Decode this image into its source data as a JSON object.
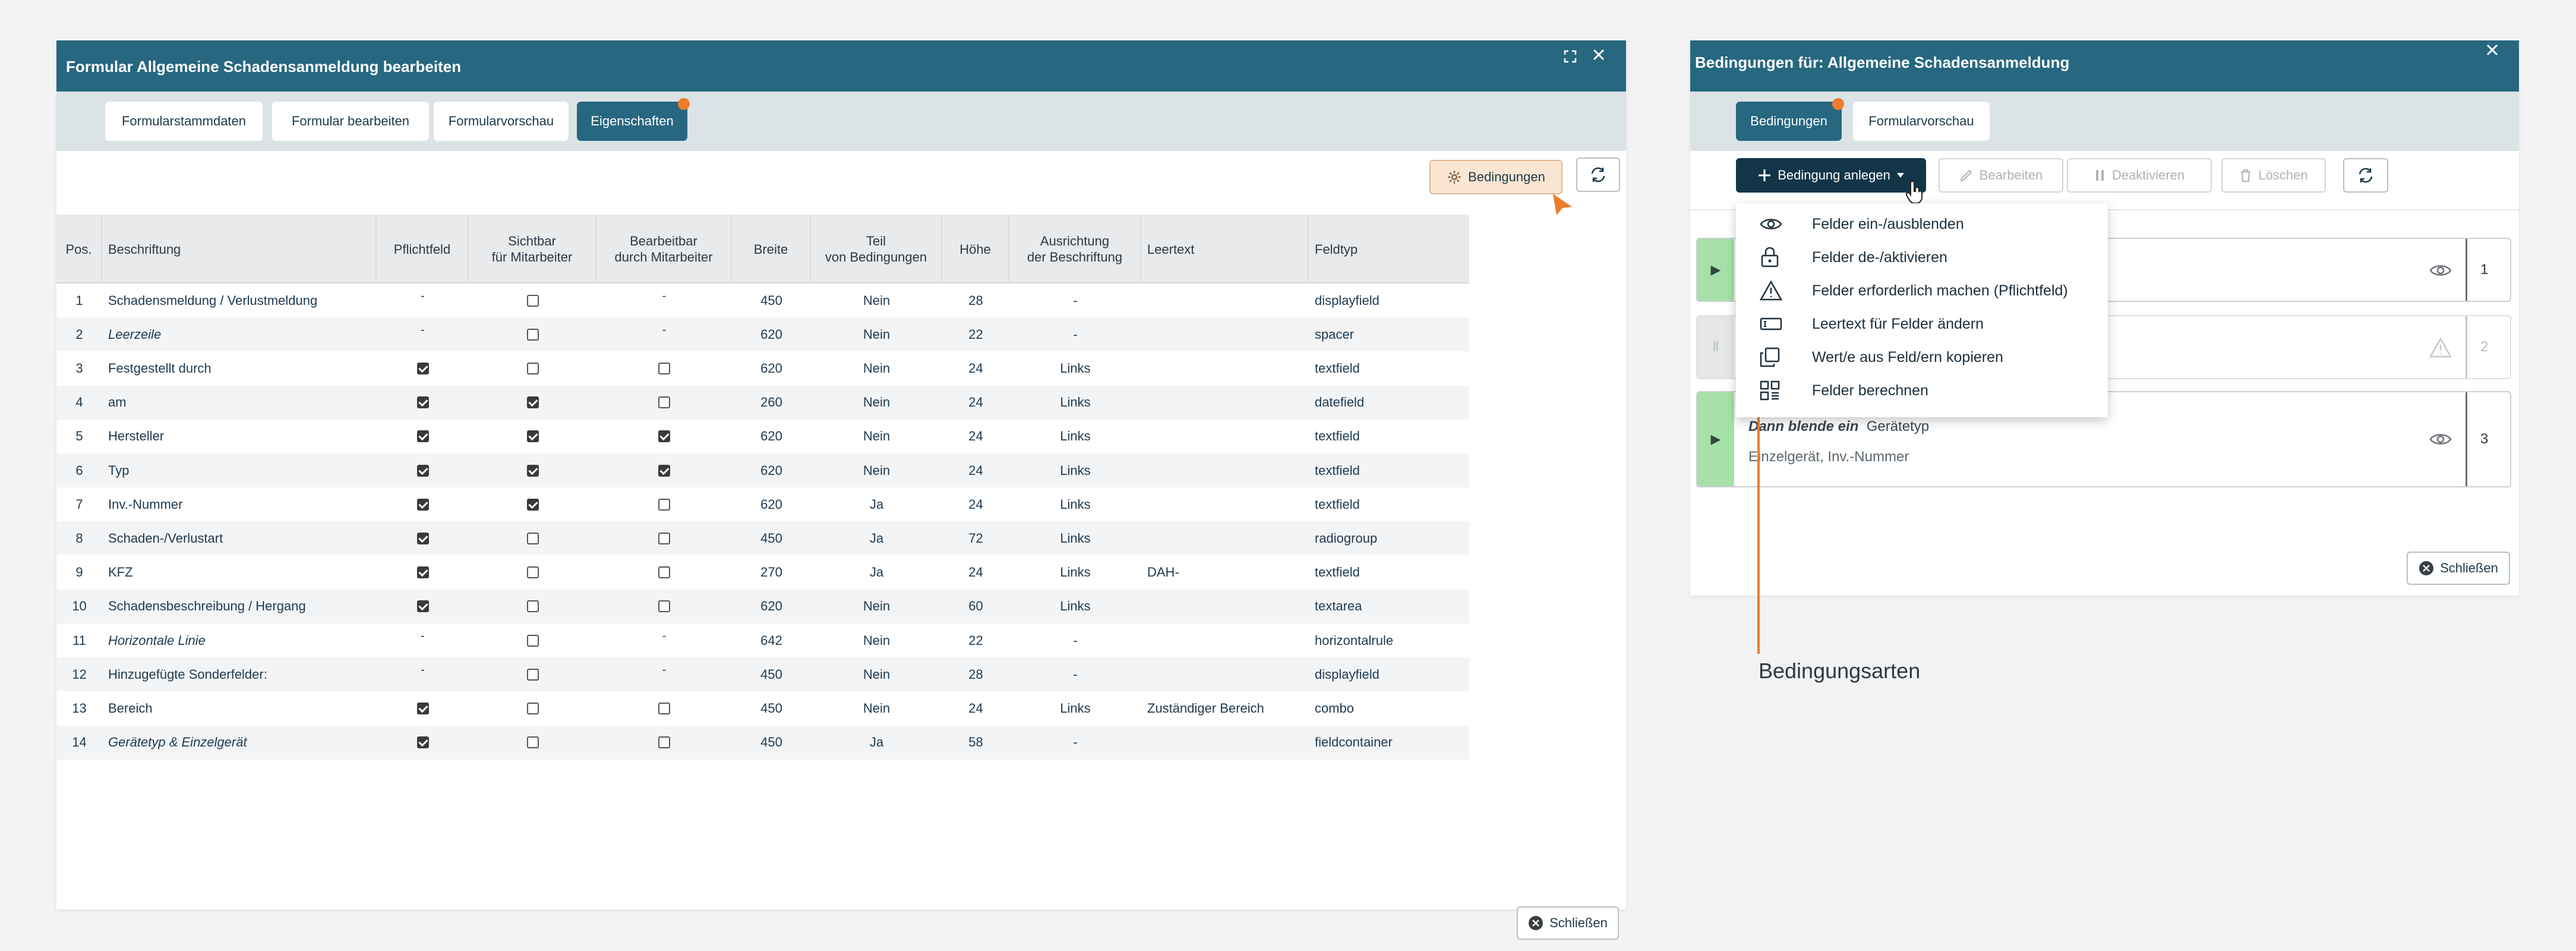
{
  "left": {
    "title": "Formular Allgemeine Schadensanmeldung bearbeiten",
    "tabs": [
      {
        "label": "Formularstammdaten"
      },
      {
        "label": "Formular bearbeiten"
      },
      {
        "label": "Formularvorschau"
      },
      {
        "label": "Eigenschaften"
      }
    ],
    "conditions_button": "Bedingungen",
    "close_button": "Schließen",
    "columns": [
      "Pos.",
      "Beschriftung",
      "Pflichtfeld",
      "Sichtbar\nfür Mitarbeiter",
      "Bearbeitbar\ndurch Mitarbeiter",
      "Breite",
      "Teil\nvon Bedingungen",
      "Höhe",
      "Ausrichtung\nder Beschriftung",
      "Leertext",
      "Feldtyp"
    ],
    "rows": [
      {
        "pos": "1",
        "label": "Schadensmeldung / Verlustmeldung",
        "italic": false,
        "req": "-",
        "vis": "off",
        "edit": "-",
        "width": "450",
        "part": "Nein",
        "height": "28",
        "align": "-",
        "empty": "",
        "type": "displayfield"
      },
      {
        "pos": "2",
        "label": "Leerzeile",
        "italic": true,
        "req": "-",
        "vis": "off",
        "edit": "-",
        "width": "620",
        "part": "Nein",
        "height": "22",
        "align": "-",
        "empty": "",
        "type": "spacer"
      },
      {
        "pos": "3",
        "label": "Festgestellt durch",
        "italic": false,
        "req": "on",
        "vis": "off",
        "edit": "off",
        "width": "620",
        "part": "Nein",
        "height": "24",
        "align": "Links",
        "empty": "",
        "type": "textfield"
      },
      {
        "pos": "4",
        "label": "am",
        "italic": false,
        "req": "on",
        "vis": "on",
        "edit": "off",
        "width": "260",
        "part": "Nein",
        "height": "24",
        "align": "Links",
        "empty": "",
        "type": "datefield"
      },
      {
        "pos": "5",
        "label": "Hersteller",
        "italic": false,
        "req": "on",
        "vis": "on",
        "edit": "on",
        "width": "620",
        "part": "Nein",
        "height": "24",
        "align": "Links",
        "empty": "",
        "type": "textfield"
      },
      {
        "pos": "6",
        "label": "Typ",
        "italic": false,
        "req": "on",
        "vis": "on",
        "edit": "on",
        "width": "620",
        "part": "Nein",
        "height": "24",
        "align": "Links",
        "empty": "",
        "type": "textfield"
      },
      {
        "pos": "7",
        "label": "Inv.-Nummer",
        "italic": false,
        "req": "on",
        "vis": "on",
        "edit": "off",
        "width": "620",
        "part": "Ja",
        "height": "24",
        "align": "Links",
        "empty": "",
        "type": "textfield"
      },
      {
        "pos": "8",
        "label": "Schaden-/Verlustart",
        "italic": false,
        "req": "on",
        "vis": "off",
        "edit": "off",
        "width": "450",
        "part": "Ja",
        "height": "72",
        "align": "Links",
        "empty": "",
        "type": "radiogroup"
      },
      {
        "pos": "9",
        "label": "KFZ",
        "italic": false,
        "req": "on",
        "vis": "off",
        "edit": "off",
        "width": "270",
        "part": "Ja",
        "height": "24",
        "align": "Links",
        "empty": "DAH-",
        "type": "textfield"
      },
      {
        "pos": "10",
        "label": "Schadensbeschreibung / Hergang",
        "italic": false,
        "req": "on",
        "vis": "off",
        "edit": "off",
        "width": "620",
        "part": "Nein",
        "height": "60",
        "align": "Links",
        "empty": "",
        "type": "textarea"
      },
      {
        "pos": "11",
        "label": "Horizontale Linie",
        "italic": true,
        "req": "-",
        "vis": "off",
        "edit": "-",
        "width": "642",
        "part": "Nein",
        "height": "22",
        "align": "-",
        "empty": "",
        "type": "horizontalrule"
      },
      {
        "pos": "12",
        "label": "Hinzugefügte Sonderfelder:",
        "italic": false,
        "req": "-",
        "vis": "off",
        "edit": "-",
        "width": "450",
        "part": "Nein",
        "height": "28",
        "align": "-",
        "empty": "",
        "type": "displayfield"
      },
      {
        "pos": "13",
        "label": "Bereich",
        "italic": false,
        "req": "on",
        "vis": "off",
        "edit": "off",
        "width": "450",
        "part": "Nein",
        "height": "24",
        "align": "Links",
        "empty": "Zuständiger Bereich",
        "type": "combo"
      },
      {
        "pos": "14",
        "label": "Gerätetyp & Einzelgerät",
        "italic": true,
        "req": "on",
        "vis": "off",
        "edit": "off",
        "width": "450",
        "part": "Ja",
        "height": "58",
        "align": "-",
        "empty": "",
        "type": "fieldcontainer"
      }
    ]
  },
  "right": {
    "title": "Bedingungen für: Allgemeine Schadensanmeldung",
    "tabs": [
      {
        "label": "Bedingungen"
      },
      {
        "label": "Formularvorschau"
      }
    ],
    "toolbar": {
      "add": "Bedingung anlegen",
      "edit": "Bearbeiten",
      "deactivate": "Deaktivieren",
      "delete": "Löschen"
    },
    "menu": [
      {
        "label": "Felder ein-/ausblenden",
        "icon": "eye-icon"
      },
      {
        "label": "Felder de-/aktivieren",
        "icon": "lock-icon"
      },
      {
        "label": "Felder erforderlich machen (Pflichtfeld)",
        "icon": "warning-icon"
      },
      {
        "label": "Leertext für Felder ändern",
        "icon": "placeholder-field-icon"
      },
      {
        "label": "Wert/e aus Feld/ern kopieren",
        "icon": "copy-icon"
      },
      {
        "label": "Felder berechnen",
        "icon": "calculate-icon"
      }
    ],
    "conditions": [
      {
        "number": "1"
      },
      {
        "number": "2"
      },
      {
        "number": "3",
        "then_label": "Dann blende ein",
        "then_value": "Gerätetyp",
        "sub": "Einzelgerät, Inv.-Nummer"
      }
    ],
    "close_button": "Schließen"
  },
  "annotation": "Bedingungsarten",
  "colors": {
    "header": "#276780",
    "tabbar": "#dbe3e6",
    "accent": "#ee7c2b",
    "dark_button": "#123548",
    "green": "#a6e0a8"
  }
}
